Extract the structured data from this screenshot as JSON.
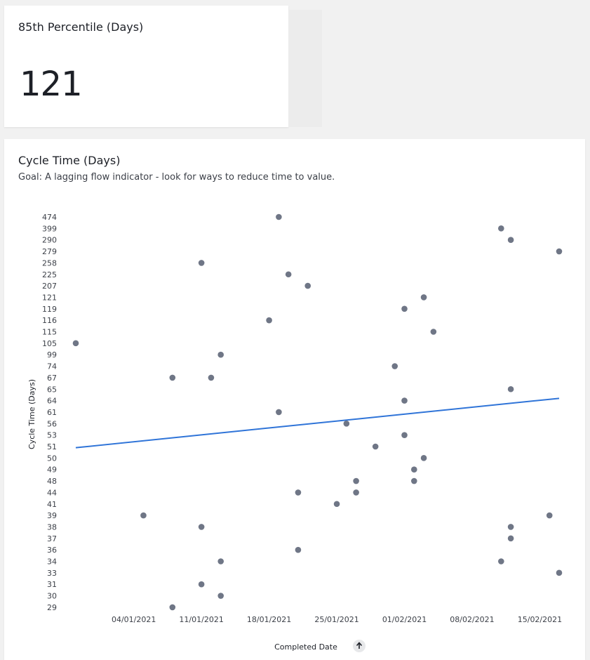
{
  "kpi": {
    "title": "85th Percentile (Days)",
    "value": "121"
  },
  "chart_card": {
    "title": "Cycle Time (Days)",
    "goal": "Goal: A lagging flow indicator - look for ways to reduce time to value."
  },
  "sort_icon": "arrow-up-icon",
  "colors": {
    "point": "#6f7686",
    "trend": "#2f74d8",
    "card": "#ffffff",
    "background": "#f1f1f1"
  },
  "chart_data": {
    "type": "scatter",
    "xlabel": "Completed Date",
    "ylabel": "Cycle Time (Days)",
    "y_scale": "categorical",
    "y_categories": [
      "29",
      "30",
      "31",
      "33",
      "34",
      "36",
      "37",
      "38",
      "39",
      "41",
      "44",
      "48",
      "49",
      "50",
      "51",
      "53",
      "56",
      "61",
      "64",
      "65",
      "67",
      "74",
      "99",
      "105",
      "115",
      "116",
      "119",
      "121",
      "207",
      "225",
      "258",
      "279",
      "290",
      "399",
      "474"
    ],
    "xlim": [
      "2020-12-29",
      "2021-02-17"
    ],
    "x_ticks": [
      "04/01/2021",
      "11/01/2021",
      "18/01/2021",
      "25/01/2021",
      "01/02/2021",
      "08/02/2021",
      "15/02/2021"
    ],
    "x_tick_dates": [
      "2021-01-04",
      "2021-01-11",
      "2021-01-18",
      "2021-01-25",
      "2021-02-01",
      "2021-02-08",
      "2021-02-15"
    ],
    "points": [
      {
        "x": "2020-12-29",
        "y": "105"
      },
      {
        "x": "2021-01-05",
        "y": "39"
      },
      {
        "x": "2021-01-08",
        "y": "67"
      },
      {
        "x": "2021-01-08",
        "y": "29"
      },
      {
        "x": "2021-01-11",
        "y": "258"
      },
      {
        "x": "2021-01-11",
        "y": "38"
      },
      {
        "x": "2021-01-11",
        "y": "31"
      },
      {
        "x": "2021-01-12",
        "y": "67"
      },
      {
        "x": "2021-01-13",
        "y": "99"
      },
      {
        "x": "2021-01-13",
        "y": "34"
      },
      {
        "x": "2021-01-13",
        "y": "30"
      },
      {
        "x": "2021-01-18",
        "y": "116"
      },
      {
        "x": "2021-01-19",
        "y": "474"
      },
      {
        "x": "2021-01-19",
        "y": "61"
      },
      {
        "x": "2021-01-20",
        "y": "225"
      },
      {
        "x": "2021-01-21",
        "y": "44"
      },
      {
        "x": "2021-01-21",
        "y": "36"
      },
      {
        "x": "2021-01-22",
        "y": "207"
      },
      {
        "x": "2021-01-25",
        "y": "41"
      },
      {
        "x": "2021-01-26",
        "y": "56"
      },
      {
        "x": "2021-01-27",
        "y": "48"
      },
      {
        "x": "2021-01-27",
        "y": "44"
      },
      {
        "x": "2021-01-29",
        "y": "51"
      },
      {
        "x": "2021-01-31",
        "y": "74"
      },
      {
        "x": "2021-02-01",
        "y": "119"
      },
      {
        "x": "2021-02-01",
        "y": "64"
      },
      {
        "x": "2021-02-01",
        "y": "53"
      },
      {
        "x": "2021-02-02",
        "y": "49"
      },
      {
        "x": "2021-02-02",
        "y": "48"
      },
      {
        "x": "2021-02-03",
        "y": "121"
      },
      {
        "x": "2021-02-03",
        "y": "50"
      },
      {
        "x": "2021-02-04",
        "y": "115"
      },
      {
        "x": "2021-02-11",
        "y": "399"
      },
      {
        "x": "2021-02-11",
        "y": "34"
      },
      {
        "x": "2021-02-12",
        "y": "290"
      },
      {
        "x": "2021-02-12",
        "y": "65"
      },
      {
        "x": "2021-02-12",
        "y": "38"
      },
      {
        "x": "2021-02-12",
        "y": "37"
      },
      {
        "x": "2021-02-16",
        "y": "39"
      },
      {
        "x": "2021-02-17",
        "y": "279"
      },
      {
        "x": "2021-02-17",
        "y": "33"
      }
    ],
    "trendline": {
      "start": {
        "x": "2020-12-29",
        "y_level": 13.9
      },
      "end": {
        "x": "2021-02-17",
        "y_level": 18.2
      }
    },
    "grid": false,
    "legend": "none"
  }
}
